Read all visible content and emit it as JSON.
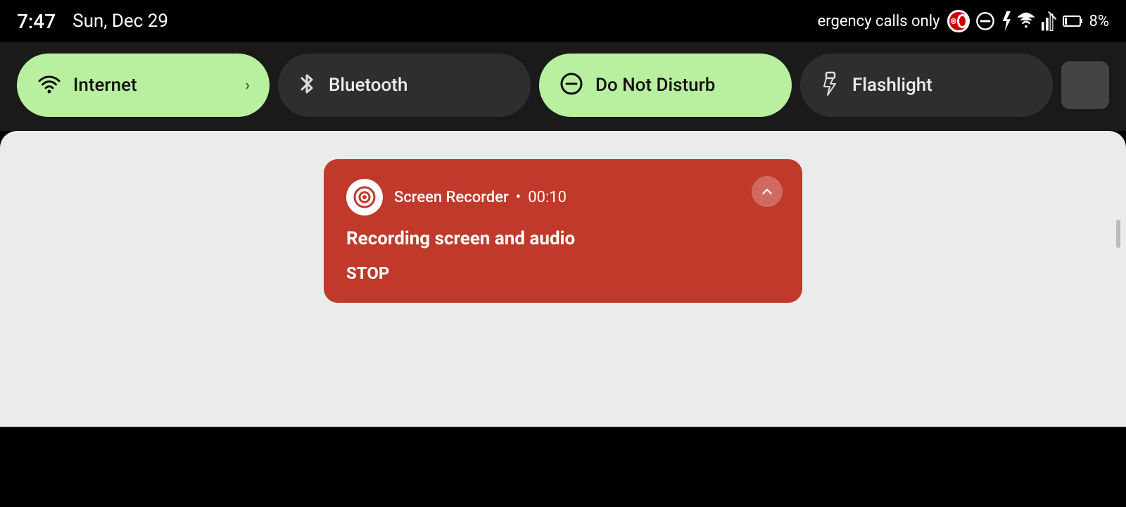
{
  "statusBar": {
    "time": "7:47",
    "date": "Sun, Dec 29",
    "emergencyText": "ergency calls only",
    "battery": "8%"
  },
  "quickTiles": {
    "internet": {
      "label": "Internet",
      "active": true,
      "hasArrow": true
    },
    "bluetooth": {
      "label": "Bluetooth",
      "active": false
    },
    "doNotDisturb": {
      "label": "Do Not Disturb",
      "active": true
    },
    "flashlight": {
      "label": "Flashlight",
      "active": false
    }
  },
  "notification": {
    "appName": "Screen Recorder",
    "dot": "•",
    "time": "00:10",
    "body": "Recording screen and audio",
    "action": "STOP"
  }
}
